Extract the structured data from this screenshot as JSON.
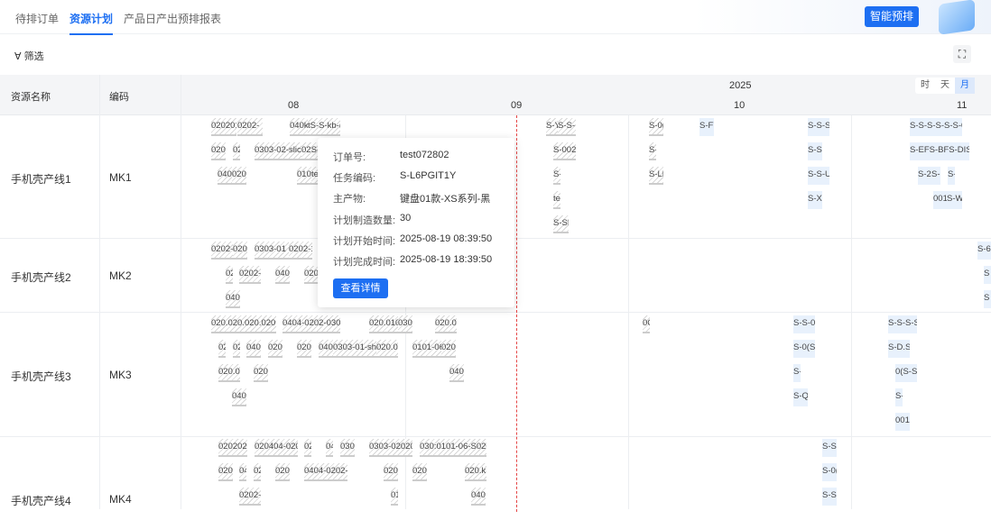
{
  "tabs": [
    {
      "label": "待排订单"
    },
    {
      "label": "资源计划"
    },
    {
      "label": "产品日产出预排报表"
    }
  ],
  "smart_schedule_label": "智能预排",
  "filter_label": "∀ 筛选",
  "fullscreen_icon": "⛶",
  "columns": {
    "name": "资源名称",
    "code": "编码"
  },
  "timeline": {
    "year": "2025",
    "months": [
      "08",
      "09",
      "10",
      "11"
    ],
    "scale": [
      {
        "label": "时"
      },
      {
        "label": "天"
      },
      {
        "label": "月"
      }
    ],
    "selected_scale": "月"
  },
  "rows": [
    {
      "name": "手机壳产线1",
      "code": "MK1",
      "bars": [
        "0202010",
        "0202-",
        "040k",
        "tS-S-kb-(",
        "020.",
        "02",
        "0303-02-slic",
        "02S-4\\",
        "040",
        "020.",
        "010",
        "te",
        "S-Y",
        "S-S-",
        "S-002",
        "S-",
        "te",
        "S-SF",
        "S-0(",
        "S-",
        "S-LF",
        "S-F7",
        "S-S-S-",
        "S-S-",
        "S-S-UI",
        "S-X\\",
        "S-S-S-S-S-S-01",
        "S-EFS-BFS-DIS-M",
        "S-2!",
        "S-",
        "S-",
        "001",
        "S-W"
      ]
    },
    {
      "name": "手机壳产线2",
      "code": "MK2",
      "bars": [
        "0202-",
        "020.",
        "0303-01",
        "0202-13",
        "02",
        "0202-",
        "040",
        "020",
        "040",
        "S-6",
        "S",
        "S"
      ]
    },
    {
      "name": "手机壳产线3",
      "code": "MK3",
      "bars": [
        "020.020.020.020.",
        "0404-0202-030",
        "020.010",
        "030",
        "020.04",
        "02",
        "02",
        "040",
        "020",
        "020",
        "040",
        "0303-01-sh",
        "020.02",
        "0101-06",
        "020",
        "020.01",
        "020",
        "040",
        "040",
        "0C",
        "S-S-0(",
        "S-0(S-",
        "S-",
        "S-Q",
        "S-S-S-S-",
        "S-D.S-",
        "0(S-S7",
        "S-",
        "001("
      ]
    },
    {
      "name": "手机壳产线4",
      "code": "MK4",
      "bars": [
        "0202020",
        "020404-020",
        "02",
        "04",
        "030",
        "0303-020202",
        "030:0101-06-S0204",
        "020",
        "04",
        "02",
        "020",
        "0404-0202-",
        "020",
        "020",
        "020.kE",
        "0202-",
        "01",
        "040",
        "S-S-",
        "S-0(",
        "S-S-"
      ]
    }
  ],
  "tooltip": {
    "fields": [
      {
        "label": "订单号:",
        "value": "test072802"
      },
      {
        "label": "任务编码:",
        "value": "S-L6PGIT1Y"
      },
      {
        "label": "主产物:",
        "value": "键盘01款-XS系列-黑"
      },
      {
        "label": "计划制造数量:",
        "value": "30"
      },
      {
        "label": "计划开始时间:",
        "value": "2025-08-19 08:39:50"
      },
      {
        "label": "计划完成时间:",
        "value": "2025-08-19 18:39:50"
      }
    ],
    "button": "查看详情"
  }
}
